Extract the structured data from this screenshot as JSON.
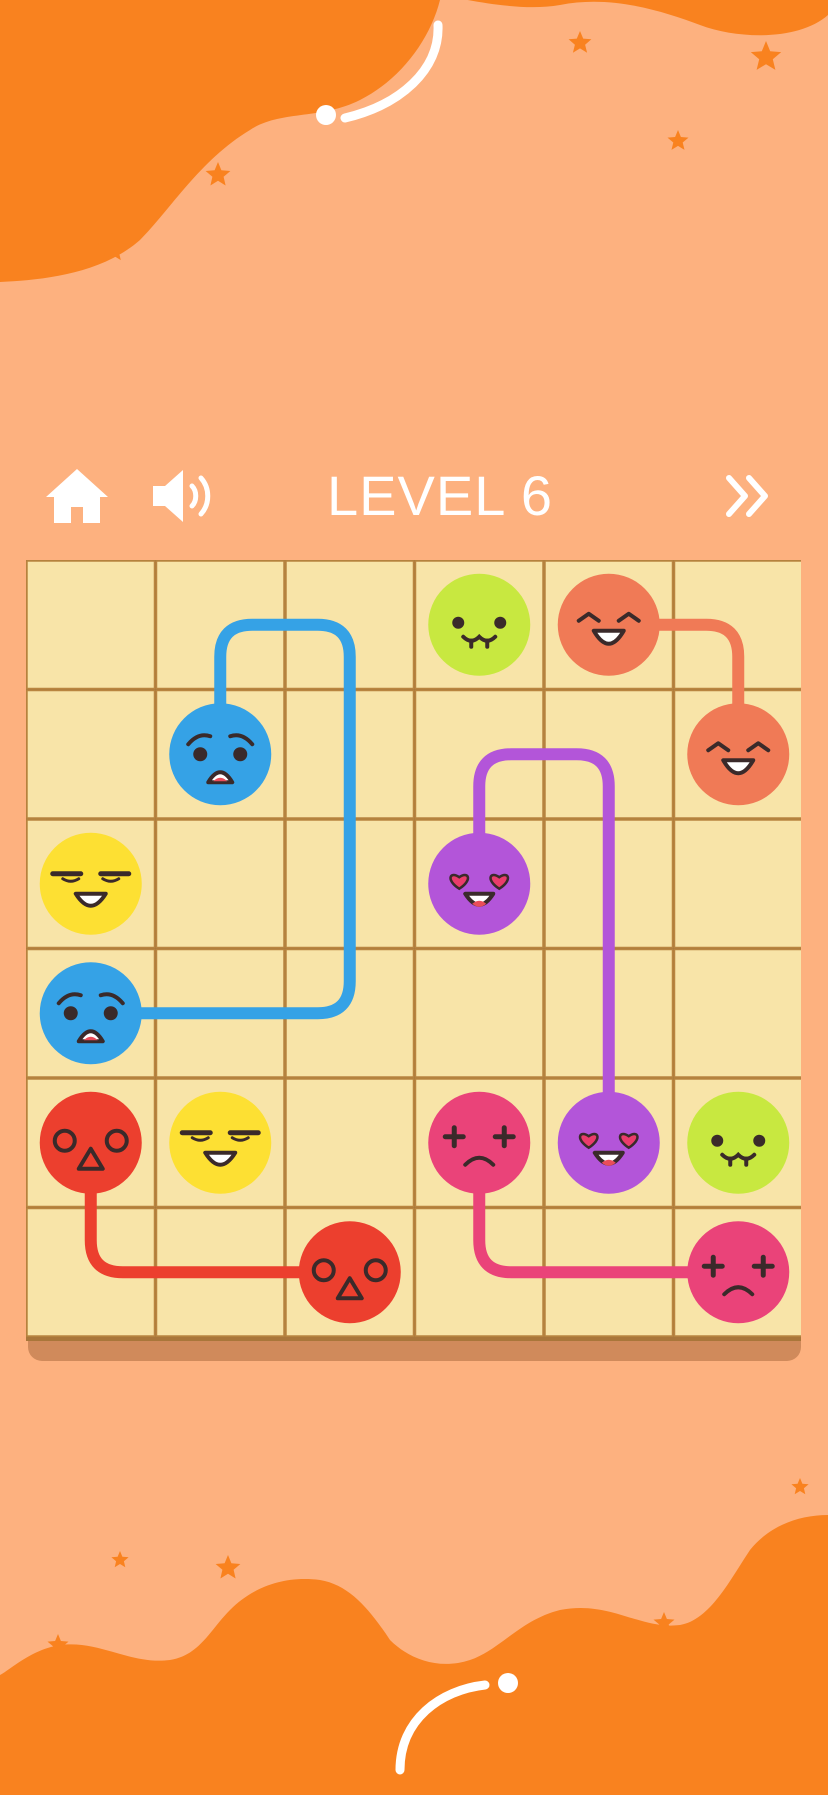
{
  "header": {
    "level_label": "LEVEL 6",
    "home_icon": "home-icon",
    "sound_icon": "speaker-volume-icon",
    "next_icon": "double-chevron-right-icon"
  },
  "colors": {
    "background": "#fdb17f",
    "blob": "#f9821f",
    "board_tile": "#f8e4a8",
    "board_border": "#b98540",
    "board_shadow": "#d08a5b",
    "text": "#ffffff"
  },
  "board": {
    "rows": 6,
    "cols": 6,
    "pieces": [
      {
        "id": "lime-1",
        "color": "#c8e840",
        "face": "dizzy",
        "row": 0,
        "col": 3
      },
      {
        "id": "salmon-1",
        "color": "#f07a56",
        "face": "happy",
        "row": 0,
        "col": 4
      },
      {
        "id": "salmon-2",
        "color": "#f07a56",
        "face": "happy",
        "row": 1,
        "col": 5
      },
      {
        "id": "blue-1",
        "color": "#35a2e6",
        "face": "worried",
        "row": 1,
        "col": 1
      },
      {
        "id": "yellow-1",
        "color": "#fde033",
        "face": "smug",
        "row": 2,
        "col": 0
      },
      {
        "id": "purple-1",
        "color": "#b355d9",
        "face": "love",
        "row": 2,
        "col": 3
      },
      {
        "id": "blue-2",
        "color": "#35a2e6",
        "face": "worried",
        "row": 3,
        "col": 0
      },
      {
        "id": "red-1",
        "color": "#ec3f2e",
        "face": "shocked",
        "row": 4,
        "col": 0
      },
      {
        "id": "yellow-2",
        "color": "#fde033",
        "face": "smug",
        "row": 4,
        "col": 1
      },
      {
        "id": "pink-1",
        "color": "#ea4379",
        "face": "dead",
        "row": 4,
        "col": 3
      },
      {
        "id": "purple-2",
        "color": "#b355d9",
        "face": "love",
        "row": 4,
        "col": 4
      },
      {
        "id": "lime-2",
        "color": "#c8e840",
        "face": "dizzy",
        "row": 4,
        "col": 5
      },
      {
        "id": "red-2",
        "color": "#ec3f2e",
        "face": "shocked",
        "row": 5,
        "col": 2
      },
      {
        "id": "pink-2",
        "color": "#ea4379",
        "face": "dead",
        "row": 5,
        "col": 5
      }
    ],
    "paths": [
      {
        "color": "#35a2e6",
        "cells": [
          [
            1,
            1
          ],
          [
            0,
            1
          ],
          [
            0,
            2
          ],
          [
            1,
            2
          ],
          [
            2,
            2
          ],
          [
            3,
            2
          ],
          [
            3,
            1
          ],
          [
            3,
            0
          ]
        ]
      },
      {
        "color": "#f07a56",
        "cells": [
          [
            0,
            4
          ],
          [
            0,
            5
          ],
          [
            1,
            5
          ]
        ]
      },
      {
        "color": "#b355d9",
        "cells": [
          [
            2,
            3
          ],
          [
            1,
            3
          ],
          [
            1,
            4
          ],
          [
            2,
            4
          ],
          [
            3,
            4
          ],
          [
            4,
            4
          ]
        ]
      },
      {
        "color": "#ec3f2e",
        "cells": [
          [
            4,
            0
          ],
          [
            5,
            0
          ],
          [
            5,
            1
          ],
          [
            5,
            2
          ]
        ]
      },
      {
        "color": "#ea4379",
        "cells": [
          [
            4,
            3
          ],
          [
            5,
            3
          ],
          [
            5,
            4
          ],
          [
            5,
            5
          ]
        ]
      }
    ]
  }
}
